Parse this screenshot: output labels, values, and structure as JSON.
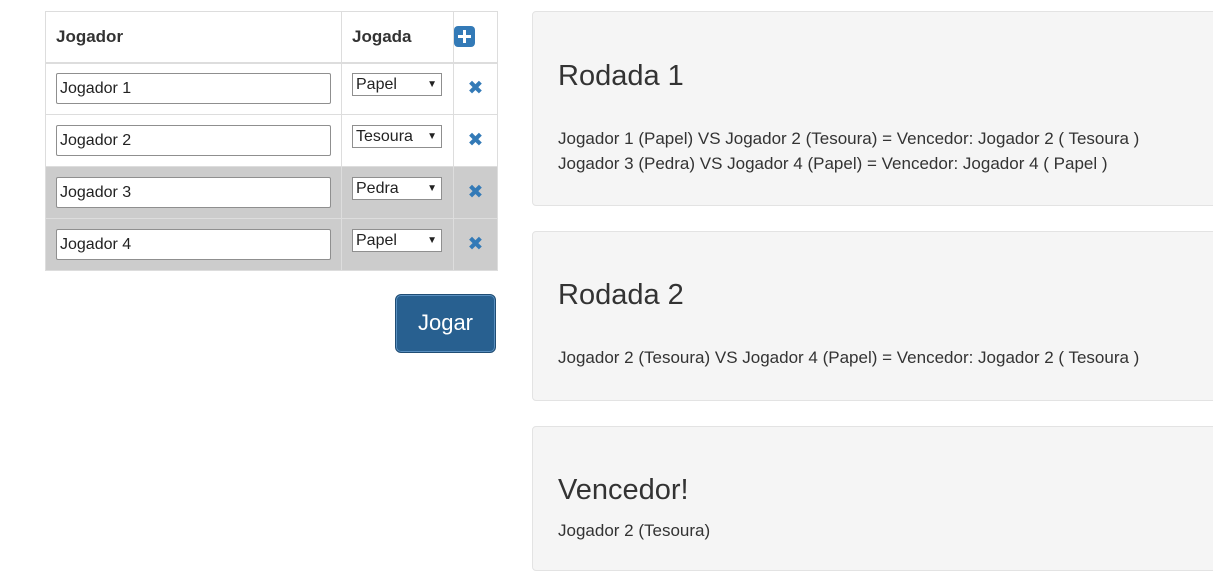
{
  "table": {
    "headers": {
      "player": "Jogador",
      "move": "Jogada"
    },
    "add_icon": "plus-square-icon",
    "remove_icon": "times-icon",
    "rows": [
      {
        "name": "Jogador 1",
        "move": "Papel",
        "shaded": false
      },
      {
        "name": "Jogador 2",
        "move": "Tesoura",
        "shaded": false
      },
      {
        "name": "Jogador 3",
        "move": "Pedra",
        "shaded": true
      },
      {
        "name": "Jogador 4",
        "move": "Papel",
        "shaded": true
      }
    ]
  },
  "play_button": {
    "label": "Jogar"
  },
  "rounds": [
    {
      "title": "Rodada 1",
      "lines": [
        "Jogador 1 (Papel) VS Jogador 2 (Tesoura) = Vencedor: Jogador 2 ( Tesoura )",
        "Jogador 3 (Pedra) VS Jogador 4 (Papel) = Vencedor: Jogador 4 ( Papel )"
      ]
    },
    {
      "title": "Rodada 2",
      "lines": [
        "Jogador 2 (Tesoura) VS Jogador 4 (Papel) = Vencedor: Jogador 2 ( Tesoura )"
      ]
    }
  ],
  "winner": {
    "title": "Vencedor!",
    "text": "Jogador 2 (Tesoura)"
  },
  "colors": {
    "accent": "#337ab7",
    "button": "#286090",
    "shaded_row": "#cccccc",
    "panel_bg": "#f5f5f5"
  }
}
